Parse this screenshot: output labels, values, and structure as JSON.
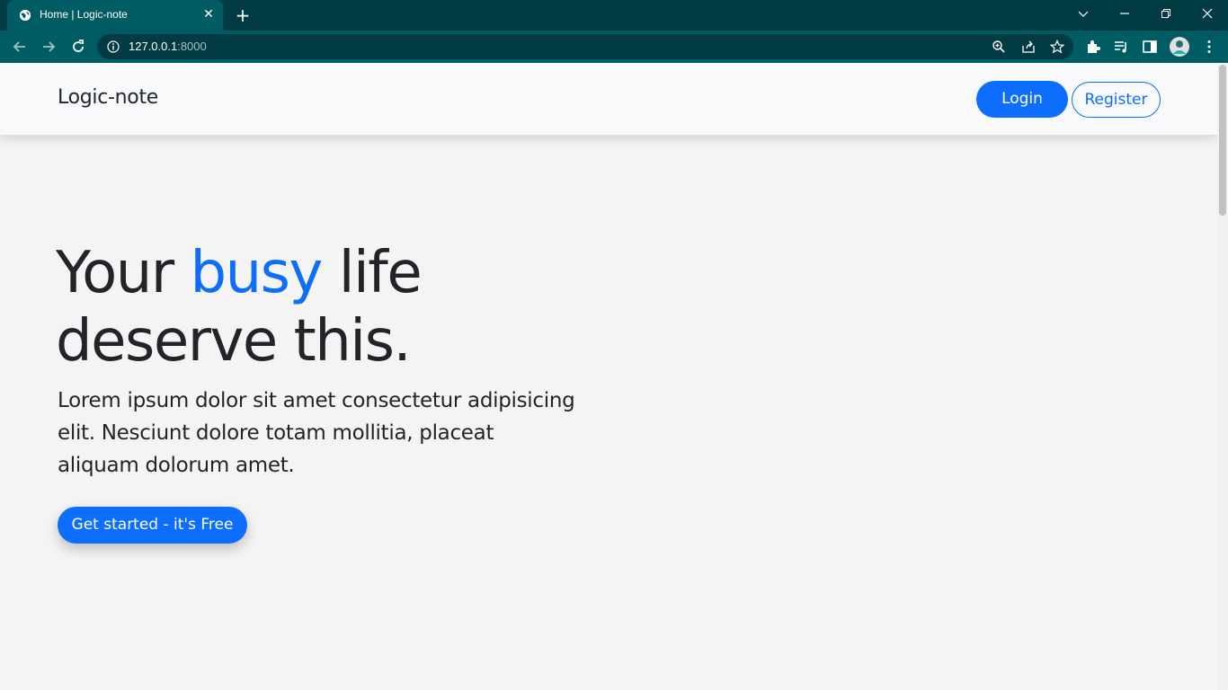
{
  "browser": {
    "tab_title": "Home | Logic-note",
    "url_host": "127.0.0.1",
    "url_port": ":8000",
    "icons": [
      "globe-icon",
      "close-icon",
      "plus-icon",
      "chevron-down-icon",
      "minimize-icon",
      "restore-icon",
      "window-close-icon",
      "back-icon",
      "forward-icon",
      "reload-icon",
      "info-icon",
      "zoom-icon",
      "share-icon",
      "star-icon",
      "extensions-icon",
      "media-icon",
      "side-panel-icon",
      "profile-avatar",
      "menu-icon"
    ]
  },
  "navbar": {
    "brand": "Logic-note",
    "login_label": "Login",
    "register_label": "Register"
  },
  "hero": {
    "title_before": "Your ",
    "title_accent": "busy",
    "title_after": " life deserve this.",
    "description": "Lorem ipsum dolor sit amet consectetur adipisicing elit. Nesciunt dolore totam mollitia, placeat aliquam dolorum amet.",
    "cta_label": "Get started - it's Free"
  },
  "colors": {
    "primary": "#0d6efd",
    "chrome_dark": "#003b44",
    "chrome_toolbar": "#005c63",
    "page_bg": "#f4f4f4",
    "text": "#212529"
  }
}
